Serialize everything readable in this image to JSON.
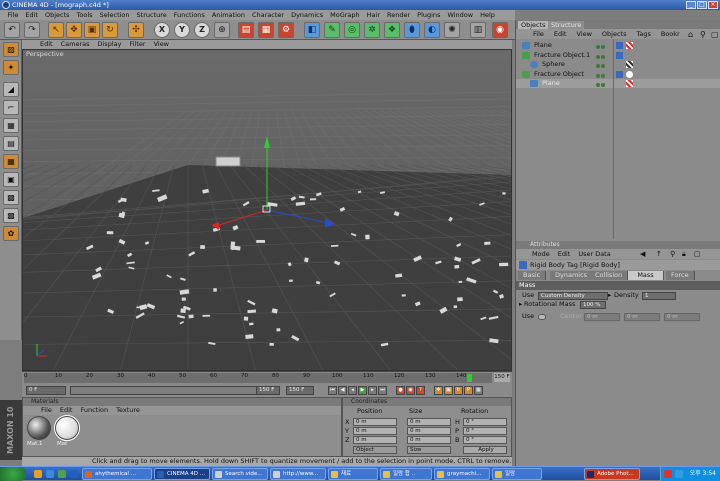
{
  "window": {
    "title": "CINEMA 4D - [mograph.c4d *]"
  },
  "menubar": [
    "File",
    "Edit",
    "Objects",
    "Tools",
    "Selection",
    "Structure",
    "Functions",
    "Animation",
    "Character",
    "Dynamics",
    "MoGraph",
    "Hair",
    "Render",
    "Plugins",
    "Window",
    "Help"
  ],
  "viewport": {
    "menu": [
      "Edit",
      "Cameras",
      "Display",
      "Filter",
      "View"
    ],
    "label": "Perspective"
  },
  "timeline": {
    "ticks": [
      "0",
      "10",
      "20",
      "30",
      "40",
      "50",
      "60",
      "70",
      "80",
      "90",
      "100",
      "110",
      "120",
      "130",
      "140"
    ],
    "end_label": "150 F",
    "current_field": "0 F",
    "start_field": "150 F",
    "end_field": "150 F"
  },
  "materials": {
    "header": "Materials",
    "menu": [
      "File",
      "Edit",
      "Function",
      "Texture"
    ],
    "items": [
      {
        "name": "Mat.1"
      },
      {
        "name": "Mat"
      }
    ]
  },
  "coordinates": {
    "header": "Coordinates",
    "cols": [
      "Position",
      "Size",
      "Rotation"
    ],
    "rows": [
      {
        "axis": "X",
        "pos": "0 m",
        "size": "0 m",
        "rot_axis": "H",
        "rot": "0 °"
      },
      {
        "axis": "Y",
        "pos": "0 m",
        "size": "0 m",
        "rot_axis": "P",
        "rot": "0 °"
      },
      {
        "axis": "Z",
        "pos": "0 m",
        "size": "0 m",
        "rot_axis": "B",
        "rot": "0 °"
      }
    ],
    "mode": "Object",
    "size_mode": "Size",
    "apply": "Apply"
  },
  "status": "Click and drag to move elements. Hold down SHIFT to quantize movement / add to the selection in point mode, CTRL to remove.",
  "object_manager": {
    "tabs": [
      "Objects",
      "Structure"
    ],
    "menu": [
      "File",
      "Edit",
      "View",
      "Objects",
      "Tags",
      "Bookr"
    ],
    "rows": [
      {
        "name": "Plane",
        "indent": 0,
        "selected": false
      },
      {
        "name": "Fracture Object.1",
        "indent": 0,
        "selected": false
      },
      {
        "name": "Sphere",
        "indent": 1,
        "selected": false
      },
      {
        "name": "Fracture Object",
        "indent": 0,
        "selected": false
      },
      {
        "name": "Plane",
        "indent": 1,
        "selected": true
      }
    ]
  },
  "attributes": {
    "header": "Attributes",
    "menu": [
      "Mode",
      "Edit",
      "User Data"
    ],
    "title": "Rigid Body Tag [Rigid Body]",
    "tabs": [
      "Basic",
      "Dynamics",
      "Collision",
      "Mass",
      "Force"
    ],
    "active_tab": "Mass",
    "section": "Mass",
    "use_label": "Use",
    "use_value": "Custom Density",
    "density_label": "Density",
    "density_value": "1",
    "rot_mass_label": "Rotational Mass",
    "rot_mass_value": "100 %",
    "use2_label": "Use",
    "center_label": "Center",
    "center_values": [
      "0 m",
      "0 m",
      "0 m"
    ]
  },
  "taskbar": {
    "buttons": [
      {
        "label": "ahythemical ..."
      },
      {
        "label": "CINEMA 4D ..."
      },
      {
        "label": "Search vide..."
      },
      {
        "label": "http://www..."
      },
      {
        "label": "재료"
      },
      {
        "label": "일람 합 .."
      },
      {
        "label": "graymachi..."
      },
      {
        "label": "일람"
      },
      {
        "label": "Adobe Phot..."
      }
    ],
    "clock": "오후 3:54"
  }
}
